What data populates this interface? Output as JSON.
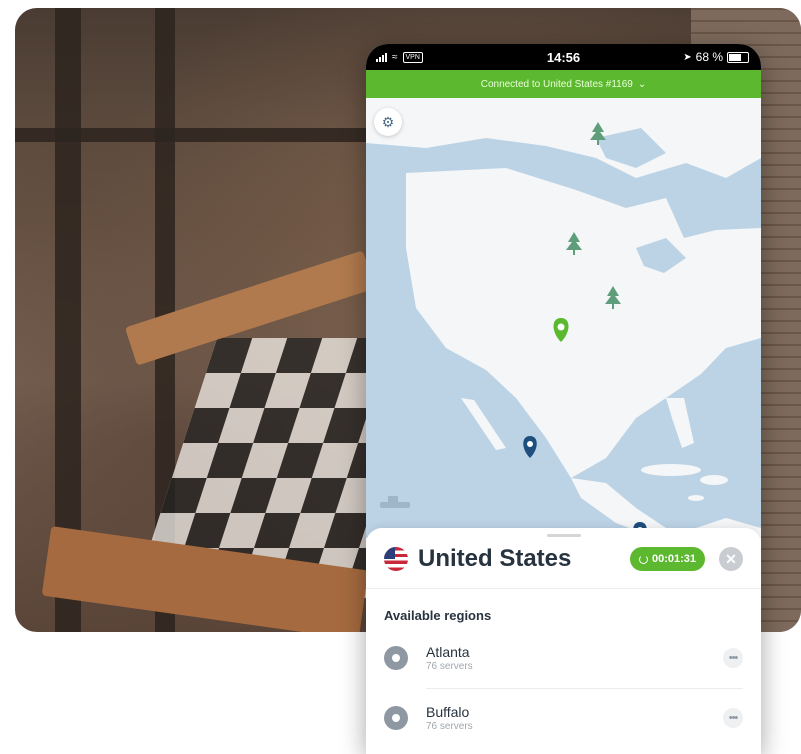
{
  "status_bar": {
    "vpn_badge": "VPN",
    "time": "14:56",
    "battery": "68 %",
    "icons": [
      "signal-icon",
      "wifi-icon",
      "location-arrow-icon",
      "battery-icon"
    ]
  },
  "connection_bar": {
    "text": "Connected to United States #1169",
    "icon": "chevron-down-icon"
  },
  "map": {
    "settings_icon": "gear-icon",
    "colors": {
      "water": "#bcd3e6",
      "land": "#f4f6f8",
      "accent": "#5cb82e",
      "pin": "#1e4f7d",
      "tree": "#5f9e7a"
    }
  },
  "panel": {
    "country": "United States",
    "timer": "00:01:31",
    "close_icon": "close-icon",
    "section_title": "Available regions",
    "regions": [
      {
        "name": "Atlanta",
        "servers": "76 servers"
      },
      {
        "name": "Buffalo",
        "servers": "76 servers"
      }
    ]
  }
}
